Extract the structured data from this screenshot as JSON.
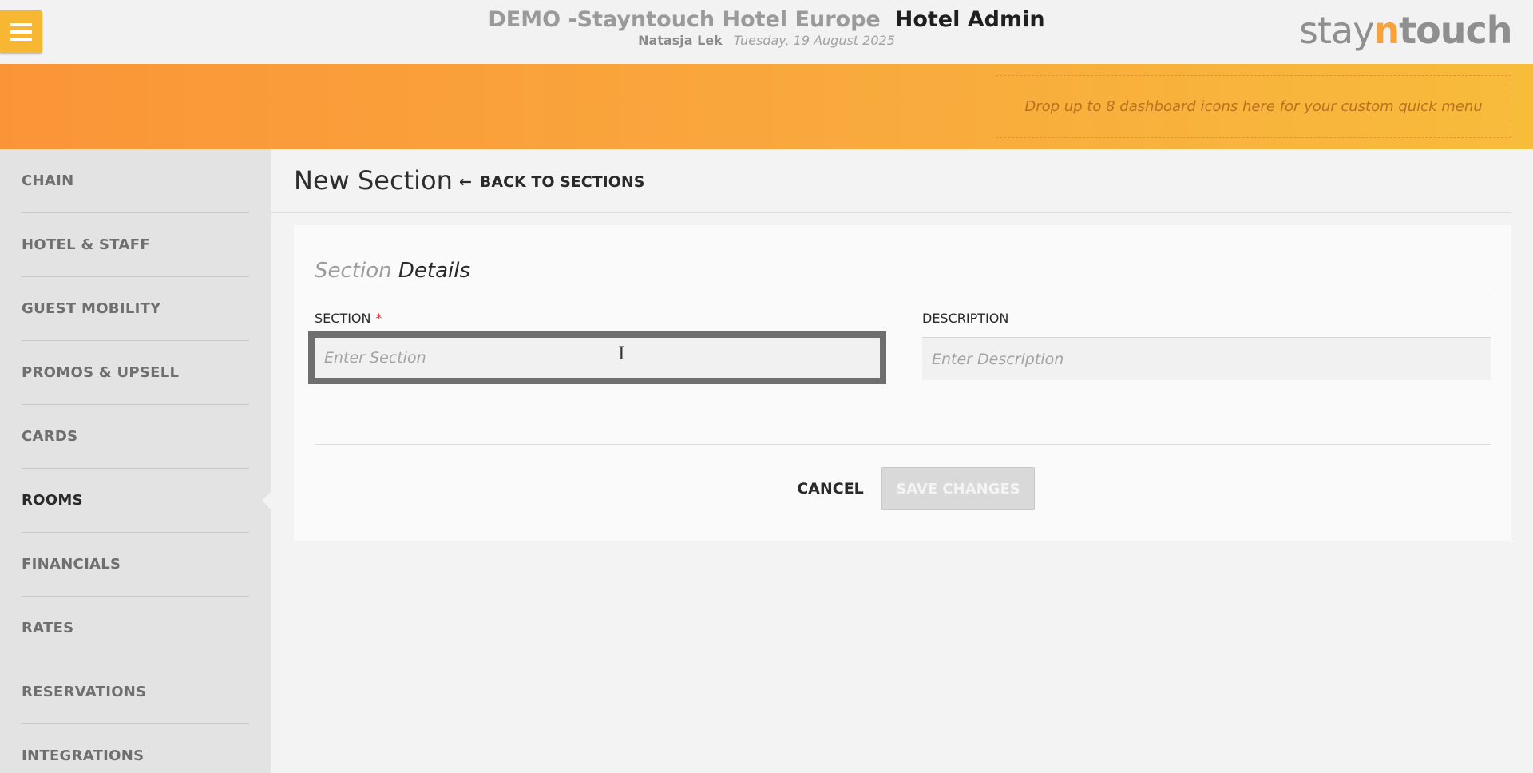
{
  "header": {
    "hotel_name": "DEMO -Stayntouch Hotel Europe",
    "app_name": "Hotel Admin",
    "user_name": "Natasja Lek",
    "date": "Tuesday, 19 August 2025",
    "logo": {
      "part1": "stay",
      "part2": "n",
      "part3": "touch"
    }
  },
  "banner": {
    "dropzone_text": "Drop up to 8 dashboard icons here for your custom quick menu"
  },
  "sidebar": {
    "items": [
      {
        "label": "CHAIN"
      },
      {
        "label": "HOTEL & STAFF"
      },
      {
        "label": "GUEST MOBILITY"
      },
      {
        "label": "PROMOS & UPSELL"
      },
      {
        "label": "CARDS"
      },
      {
        "label": "ROOMS",
        "active": true
      },
      {
        "label": "FINANCIALS"
      },
      {
        "label": "RATES"
      },
      {
        "label": "RESERVATIONS"
      },
      {
        "label": "INTEGRATIONS"
      }
    ]
  },
  "page": {
    "title": "New Section",
    "back_link": "BACK TO SECTIONS",
    "back_icon": "arrow-left-icon"
  },
  "form": {
    "card_title_light": "Section",
    "card_title_dark": "Details",
    "section_label": "SECTION",
    "required_mark": "*",
    "section_placeholder": "Enter Section",
    "section_value": "",
    "description_label": "DESCRIPTION",
    "description_placeholder": "Enter Description",
    "description_value": "",
    "cancel_label": "CANCEL",
    "save_label": "SAVE CHANGES"
  },
  "colors": {
    "accent": "#f7b733",
    "banner_start": "#fa9537",
    "banner_end": "#f8bc3b"
  }
}
